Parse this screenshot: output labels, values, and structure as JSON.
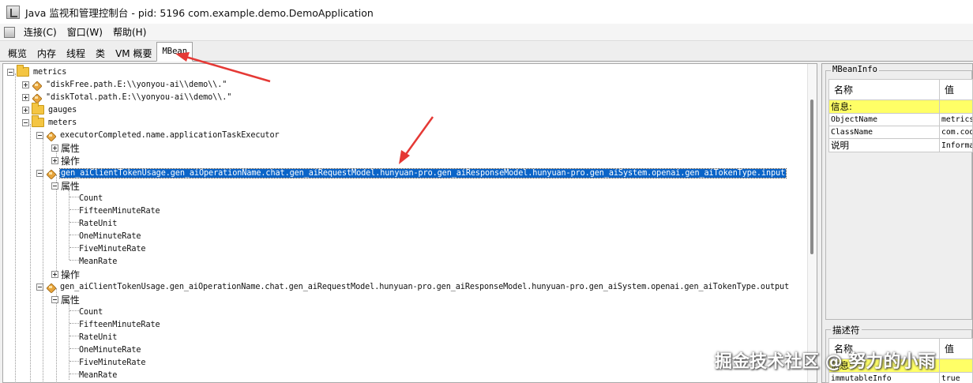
{
  "window": {
    "title": "Java 监视和管理控制台 - pid: 5196 com.example.demo.DemoApplication"
  },
  "menubar": {
    "items": [
      "连接(C)",
      "窗口(W)",
      "帮助(H)"
    ]
  },
  "tabs": [
    "概览",
    "内存",
    "线程",
    "类",
    "VM 概要",
    "MBean"
  ],
  "tree": {
    "metrics": "metrics",
    "disk_free": "\"diskFree.path.E:\\\\yonyou-ai\\\\demo\\\\.\"",
    "disk_total": "\"diskTotal.path.E:\\\\yonyou-ai\\\\demo\\\\.\"",
    "gauges": "gauges",
    "meters": "meters",
    "executor_completed": "executorCompleted.name.applicationTaskExecutor",
    "attributes": "属性",
    "operations": "操作",
    "token_input": "gen_aiClientTokenUsage.gen_aiOperationName.chat.gen_aiRequestModel.hunyuan-pro.gen_aiResponseModel.hunyuan-pro.gen_aiSystem.openai.gen_aiTokenType.input",
    "token_output": "gen_aiClientTokenUsage.gen_aiOperationName.chat.gen_aiRequestModel.hunyuan-pro.gen_aiResponseModel.hunyuan-pro.gen_aiSystem.openai.gen_aiTokenType.output",
    "meter_attrs": [
      "Count",
      "FifteenMinuteRate",
      "RateUnit",
      "OneMinuteRate",
      "FiveMinuteRate",
      "MeanRate"
    ]
  },
  "mbeaninfo": {
    "title": "MBeanInfo",
    "header": {
      "name": "名称",
      "value": "值"
    },
    "rows": [
      {
        "name": "信息:",
        "value": ""
      },
      {
        "name": "ObjectName",
        "value": "metrics"
      },
      {
        "name": "ClassName",
        "value": "com.cod"
      },
      {
        "name": "说明",
        "value": "Informa"
      }
    ]
  },
  "descriptor": {
    "title": "描述符",
    "header": {
      "name": "名称",
      "value": "值"
    },
    "rows": [
      {
        "name": "信息:",
        "value": ""
      },
      {
        "name": "immutableInfo",
        "value": "true"
      }
    ]
  },
  "watermark": "掘金技术社区 @ 努力的小雨",
  "colors": {
    "selection": "#0a64c8",
    "highlight_row": "#ffff66",
    "annotation_arrow": "#e53935"
  }
}
